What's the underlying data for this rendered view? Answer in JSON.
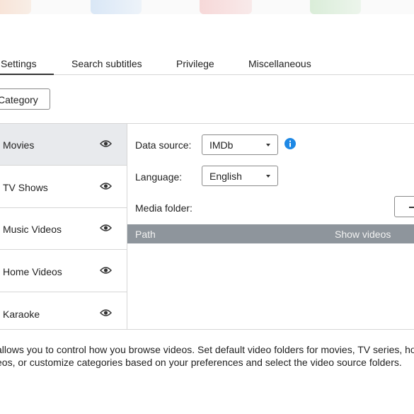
{
  "tabs": [
    {
      "label": "Settings",
      "active": true
    },
    {
      "label": "Search subtitles",
      "active": false
    },
    {
      "label": "Privilege",
      "active": false
    },
    {
      "label": "Miscellaneous",
      "active": false
    }
  ],
  "category_button": "Category",
  "categories": [
    {
      "label": "Movies",
      "selected": true,
      "icon": "eye-icon"
    },
    {
      "label": "TV Shows",
      "selected": false,
      "icon": "eye-icon"
    },
    {
      "label": "Music Videos",
      "selected": false,
      "icon": "eye-icon"
    },
    {
      "label": "Home Videos",
      "selected": false,
      "icon": "eye-icon"
    },
    {
      "label": "Karaoke",
      "selected": false,
      "icon": "eye-icon"
    }
  ],
  "form": {
    "data_source_label": "Data source:",
    "data_source_value": "IMDb",
    "language_label": "Language:",
    "language_value": "English",
    "media_folder_label": "Media folder:",
    "info_icon": "info-icon",
    "add_icon": "plus-icon"
  },
  "table": {
    "columns": [
      "Path",
      "Show videos"
    ]
  },
  "description": {
    "line1": "allows you to control how you browse videos. Set default video folders for movies, TV series, home",
    "line2": "eos, or customize categories based on your preferences and select the video source folders."
  },
  "colors": {
    "accent": "#1e88e5",
    "selected_bg": "#e8eaed",
    "table_header_bg": "#8e959c"
  }
}
